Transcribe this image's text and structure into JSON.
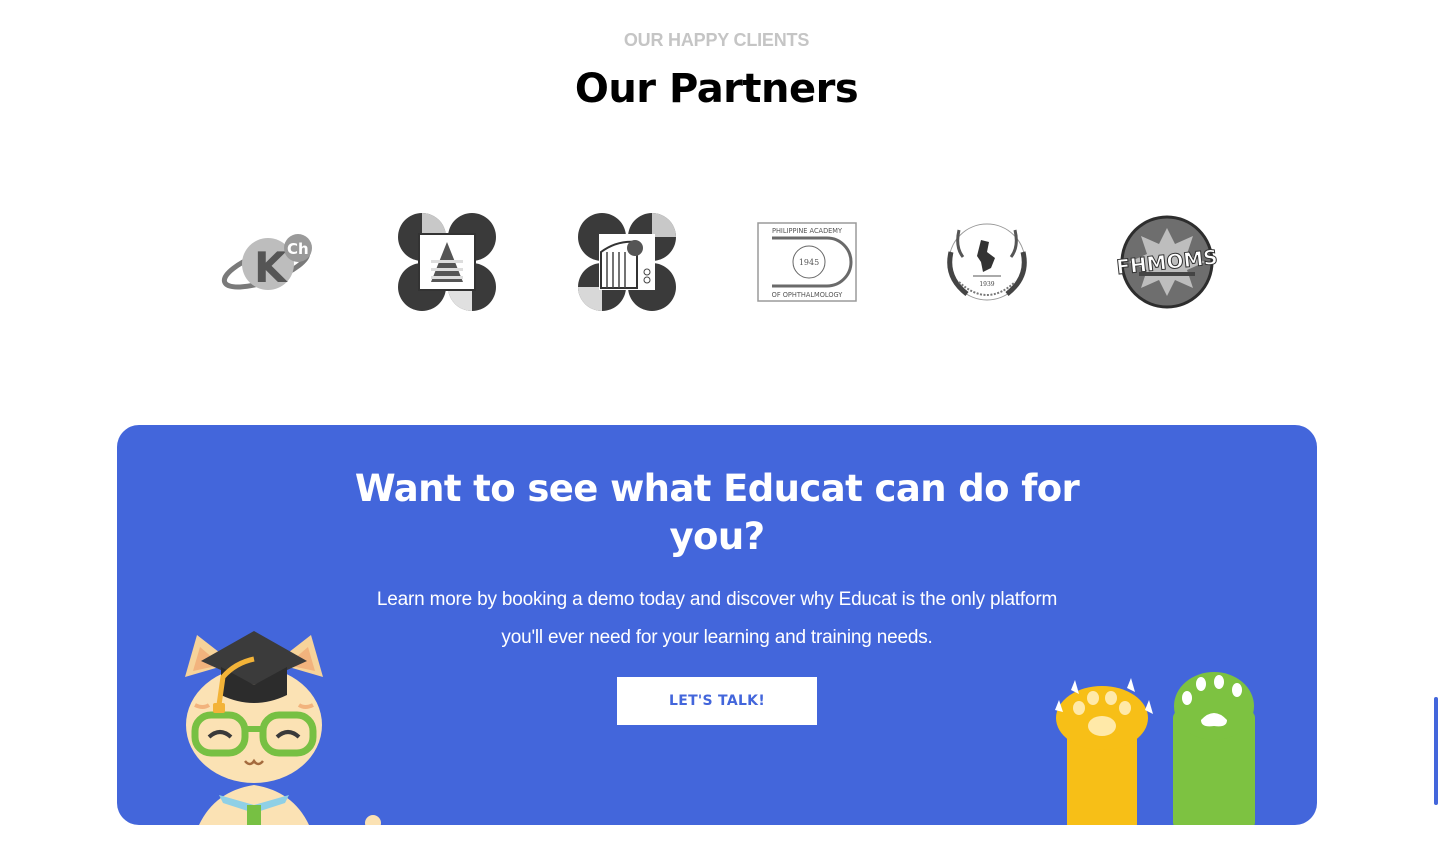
{
  "partners_section": {
    "eyebrow": "OUR HAPPY CLIENTS",
    "title": "Our Partners",
    "logos": [
      {
        "name": "kch-logo",
        "text": "Ch"
      },
      {
        "name": "government-seal-logo-1"
      },
      {
        "name": "government-seal-logo-2"
      },
      {
        "name": "philippine-academy-ophthalmology-logo",
        "text_top": "PHILIPPINE ACADEMY",
        "year": "1945",
        "text_bottom": "OF OPHTHALMOLOGY"
      },
      {
        "name": "philippine-society-general-surgeons-logo",
        "year": "1939"
      },
      {
        "name": "fhmoms-logo",
        "text": "FHMOMS"
      }
    ]
  },
  "cta": {
    "title": "Want to see what Educat can do for you?",
    "text": "Learn more by booking a demo today and discover why Educat is the only platform you'll ever need for your learning and training needs.",
    "button_label": "LET'S TALK!",
    "colors": {
      "background": "#4366db",
      "button_bg": "#ffffff",
      "button_text": "#4366db"
    }
  }
}
